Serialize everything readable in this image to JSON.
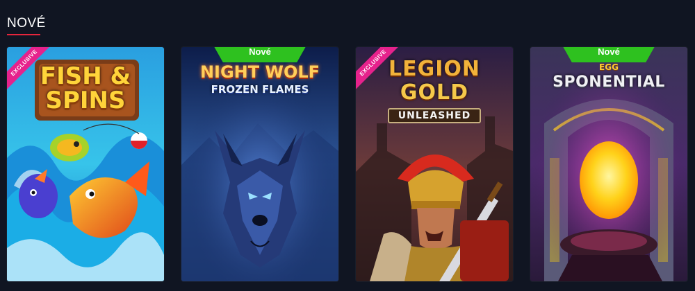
{
  "section": {
    "title": "NOVÉ"
  },
  "colors": {
    "accent": "#e5263c",
    "badge_green": "#2ec11f",
    "exclusive_pink": "#e6228c",
    "bg": "#101522"
  },
  "games": [
    {
      "title_line1": "FISH &",
      "title_line2": "SPINS",
      "ribbon": "EXCLUSIVE"
    },
    {
      "title_line1": "NIGHT WOLF",
      "title_line2": "FROZEN FLAMES",
      "badge": "Nové"
    },
    {
      "title_line1": "LEGION",
      "title_line2": "GOLD",
      "title_line3": "UNLEASHED",
      "ribbon": "EXCLUSIVE"
    },
    {
      "title_line1": "EGG",
      "title_line2": "SPONENTIAL",
      "badge": "Nové"
    }
  ]
}
